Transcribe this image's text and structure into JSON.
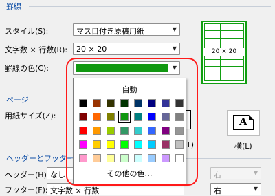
{
  "sections": {
    "lines": "罫線",
    "page": "ページ",
    "header_footer": "ヘッダーとフッター"
  },
  "fields": {
    "style_label": "スタイル(S):",
    "style_value": "マス目付き原稿用紙",
    "chars_label": "文字数 × 行数(R):",
    "chars_value": "20 × 20",
    "color_label": "罫線の色(C):",
    "color_value": "#109810",
    "paper_label": "用紙サイズ(Z):",
    "header_label": "ヘッダー(H):",
    "header_value": "なし",
    "header_pos_value": "右",
    "footer_label": "フッター(F):",
    "footer_value": "文字数 × 行数",
    "footer_pos_value": "右"
  },
  "preview": {
    "caption": "20 × 20"
  },
  "orientation": {
    "portrait_partial": "T)",
    "landscape_label": "横(L)",
    "glyph": "A"
  },
  "color_popup": {
    "auto_label": "自動",
    "more_label": "その他の色…",
    "selected": "#109810",
    "swatches": [
      [
        "#000000",
        "#993300",
        "#333300",
        "#003300",
        "#003366",
        "#000080",
        "#333399",
        "#333333"
      ],
      [
        "#800000",
        "#ff6600",
        "#808000",
        "#109810",
        "#008080",
        "#0000ff",
        "#666699",
        "#808080"
      ],
      [
        "#ff0000",
        "#ff9900",
        "#99cc00",
        "#339966",
        "#33cccc",
        "#3366ff",
        "#800080",
        "#969696"
      ],
      [
        "#ff00ff",
        "#ffcc00",
        "#ffff00",
        "#00ff00",
        "#00ffff",
        "#00ccff",
        "#993366",
        "#c0c0c0"
      ],
      [
        "#ff99cc",
        "#ffcc99",
        "#ffff99",
        "#ccffcc",
        "#ccffff",
        "#99ccff",
        "#cc99ff",
        "#ffffff"
      ]
    ]
  }
}
